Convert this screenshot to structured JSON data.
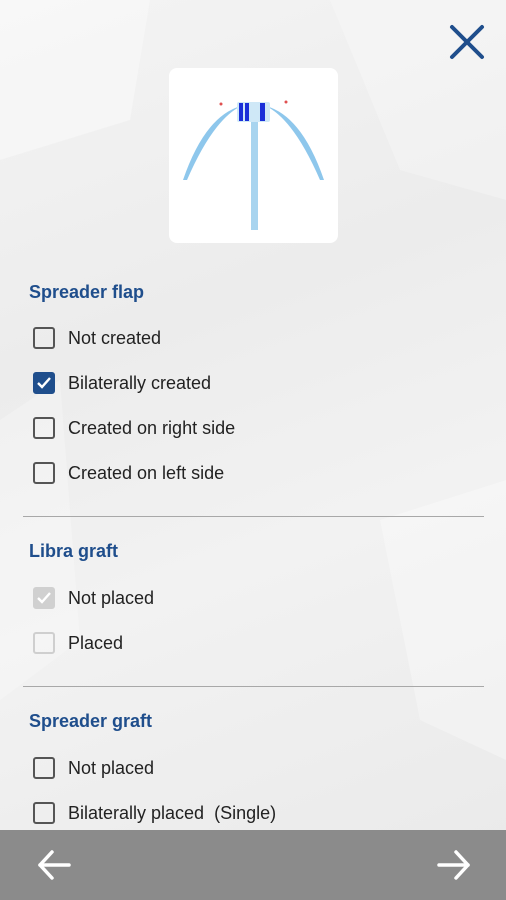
{
  "icons": {
    "close": "close-icon",
    "back": "arrow-left-icon",
    "forward": "arrow-right-icon"
  },
  "colors": {
    "accent": "#1f4e8c",
    "bottom_bar": "#8b8b8b",
    "disabled": "#d0d0d0"
  },
  "sections": [
    {
      "title": "Spreader flap",
      "options": [
        {
          "label": "Not created",
          "checked": false,
          "disabled": false
        },
        {
          "label": "Bilaterally created",
          "checked": true,
          "disabled": false
        },
        {
          "label": "Created on right side",
          "checked": false,
          "disabled": false
        },
        {
          "label": "Created on left side",
          "checked": false,
          "disabled": false
        }
      ]
    },
    {
      "title": "Libra graft",
      "options": [
        {
          "label": "Not placed",
          "checked": true,
          "disabled": true
        },
        {
          "label": "Placed",
          "checked": false,
          "disabled": true
        }
      ]
    },
    {
      "title": "Spreader graft",
      "options": [
        {
          "label": "Not placed",
          "checked": false,
          "disabled": false
        },
        {
          "label": "Bilaterally placed  (Single)",
          "checked": false,
          "disabled": false
        }
      ]
    }
  ]
}
